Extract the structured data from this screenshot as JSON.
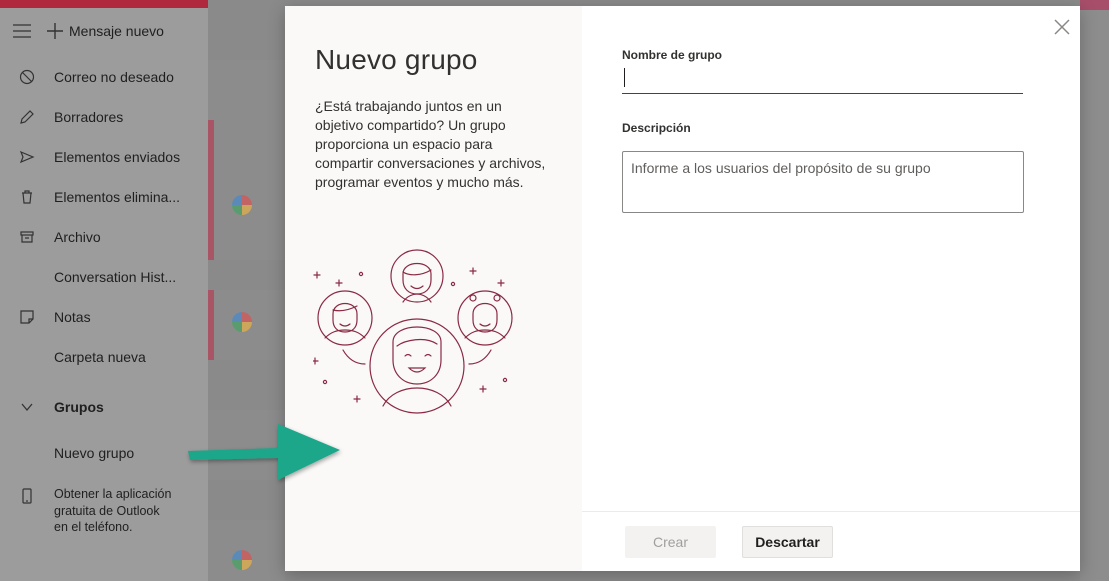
{
  "sidebar": {
    "new_message": "Mensaje nuevo",
    "items": [
      {
        "label": "Correo no deseado",
        "icon": "block-icon"
      },
      {
        "label": "Borradores",
        "icon": "pencil-icon"
      },
      {
        "label": "Elementos enviados",
        "icon": "send-icon"
      },
      {
        "label": "Elementos elimina...",
        "icon": "trash-icon"
      },
      {
        "label": "Archivo",
        "icon": "archive-icon"
      },
      {
        "label": "Conversation Hist...",
        "icon": ""
      },
      {
        "label": "Notas",
        "icon": "note-icon"
      },
      {
        "label": "Carpeta nueva",
        "icon": ""
      }
    ],
    "groups_header": "Grupos",
    "new_group": "Nuevo grupo",
    "app_promo": "Obtener la aplicación gratuita de Outlook en el teléfono."
  },
  "dialog": {
    "title": "Nuevo grupo",
    "description": "¿Está trabajando juntos en un objetivo compartido? Un grupo proporciona un espacio para compartir conversaciones y archivos, programar eventos y mucho más.",
    "group_name_label": "Nombre de grupo",
    "group_name_value": "",
    "description_label": "Descripción",
    "description_placeholder": "Informe a los usuarios del propósito de su grupo",
    "create_button": "Crear",
    "discard_button": "Descartar"
  },
  "colors": {
    "accent": "#7a2a3a",
    "illustration": "#8a2a44",
    "tutorial_arrow": "#1aa68a",
    "brand_bar": "#b0283e"
  }
}
